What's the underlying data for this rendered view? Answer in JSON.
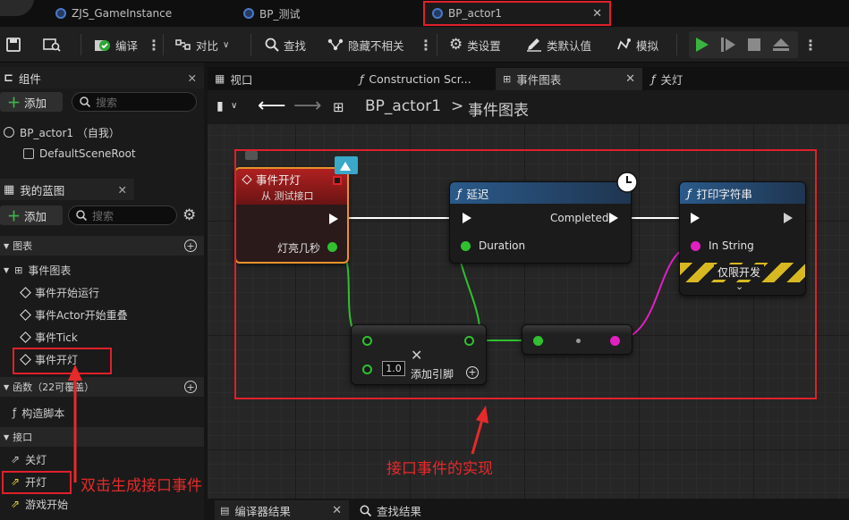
{
  "tabs": [
    {
      "label": "ZJS_GameInstance"
    },
    {
      "label": "BP_测试"
    },
    {
      "label": "BP_actor1"
    }
  ],
  "toolbar": {
    "compile": "编译",
    "diff": "对比",
    "find": "查找",
    "hide_unrelated": "隐藏不相关",
    "class_settings": "类设置",
    "class_defaults": "类默认值",
    "simulate": "模拟"
  },
  "components": {
    "title": "组件",
    "add": "添加",
    "search_placeholder": "搜索",
    "root_item": "BP_actor1 （自我）",
    "child_item": "DefaultSceneRoot"
  },
  "my_blueprint": {
    "title": "我的蓝图",
    "add": "添加",
    "search_placeholder": "搜索",
    "graphs_section": "图表",
    "event_graph": "事件图表",
    "events": [
      "事件开始运行",
      "事件Actor开始重叠",
      "事件Tick",
      "事件开灯"
    ],
    "functions_section": "函数（22可覆盖）",
    "construction_script": "构造脚本",
    "interfaces_section": "接口",
    "interface_items": [
      "关灯",
      "开灯",
      "游戏开始"
    ]
  },
  "graph_tabs": [
    {
      "label": "视口"
    },
    {
      "label": "Construction Scr..."
    },
    {
      "label": "事件图表"
    },
    {
      "label": "关灯"
    }
  ],
  "breadcrumb": {
    "root": "BP_actor1",
    "separator": ">",
    "current": "事件图表"
  },
  "nodes": {
    "event": {
      "title": "事件开灯",
      "subtitle": "从 测试接口",
      "pin": "灯亮几秒"
    },
    "delay": {
      "title": "延迟",
      "out_pin": "Completed",
      "in_pin": "Duration"
    },
    "print": {
      "title": "打印字符串",
      "in_pin": "In String",
      "dev_only": "仅限开发"
    },
    "add": {
      "default_value": "1.0",
      "add_pin": "添加引脚"
    }
  },
  "bottom_tabs": [
    {
      "label": "编译器结果"
    },
    {
      "label": "查找结果"
    }
  ],
  "annotations": {
    "double_click": "双击生成接口事件",
    "implementation": "接口事件的实现"
  },
  "colors": {
    "highlight": "#e0202a",
    "exec_wire": "#ffffff",
    "float_wire": "#30c030",
    "string_pin": "#e020c0"
  }
}
